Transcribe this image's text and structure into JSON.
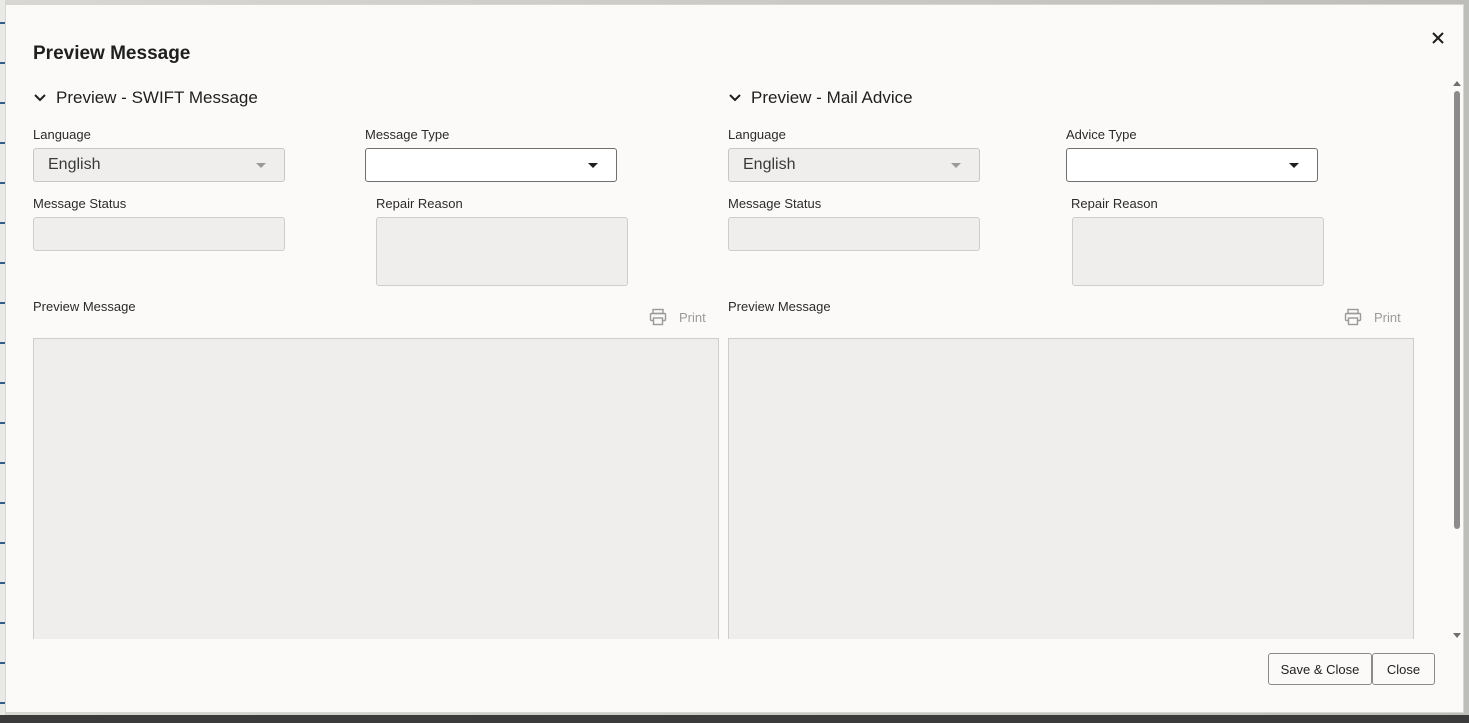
{
  "dialog": {
    "title": "Preview Message"
  },
  "swift": {
    "section_title": "Preview - SWIFT Message",
    "language_label": "Language",
    "language_value": "English",
    "message_type_label": "Message Type",
    "message_type_value": "",
    "message_status_label": "Message Status",
    "repair_reason_label": "Repair Reason",
    "preview_label": "Preview Message",
    "print_label": "Print"
  },
  "mail": {
    "section_title": "Preview - Mail Advice",
    "language_label": "Language",
    "language_value": "English",
    "advice_type_label": "Advice Type",
    "advice_type_value": "",
    "message_status_label": "Message Status",
    "repair_reason_label": "Repair Reason",
    "preview_label": "Preview Message",
    "print_label": "Print"
  },
  "footer": {
    "save_close_label": "Save & Close",
    "close_label": "Close"
  },
  "icons": {
    "close": "close-icon",
    "collapse": "chevron-down-icon",
    "print": "printer-icon",
    "dropdown": "caret-down-icon"
  }
}
